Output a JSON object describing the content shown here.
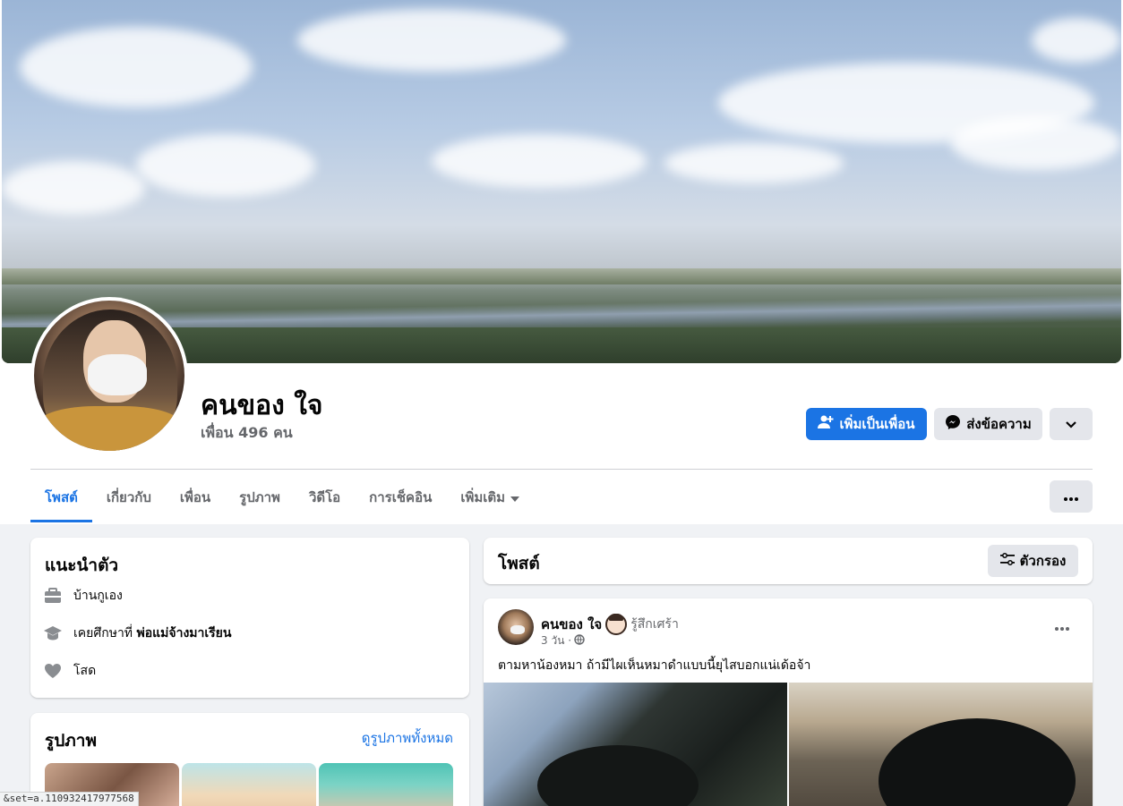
{
  "profile": {
    "name": "คนของ ใจ",
    "friends": "เพื่อน 496 คน"
  },
  "actions": {
    "add_friend": "เพิ่มเป็นเพื่อน",
    "message": "ส่งข้อความ"
  },
  "tabs": [
    {
      "label": "โพสต์"
    },
    {
      "label": "เกี่ยวกับ"
    },
    {
      "label": "เพื่อน"
    },
    {
      "label": "รูปภาพ"
    },
    {
      "label": "วิดีโอ"
    },
    {
      "label": "การเช็คอิน"
    },
    {
      "label": "เพิ่มเติม"
    }
  ],
  "intro": {
    "title": "แนะนำตัว",
    "work": "บ้านกูเอง",
    "education_prefix": "เคยศึกษาที่ ",
    "education_school": "พ่อแม่จ้างมาเรียน",
    "relationship": "โสด"
  },
  "photos": {
    "title": "รูปภาพ",
    "see_all": "ดูรูปภาพทั้งหมด"
  },
  "posts": {
    "title": "โพสต์",
    "filter": "ตัวกรอง"
  },
  "post": {
    "author": "คนของ ใจ",
    "feeling": "รู้สึกเศร้า",
    "time": "3 วัน ·",
    "text": "ตามหาน้องหมา ถ้ามีไผเห็นหมาดำแบบนี้ยุไสบอกแน่เด้อจ้า"
  },
  "status_bar": "&set=a.110932417977568",
  "colors": {
    "accent": "#1b74e4",
    "secondary_button": "#e4e6eb",
    "page_background": "#f0f2f5",
    "muted_text": "#65676b"
  }
}
